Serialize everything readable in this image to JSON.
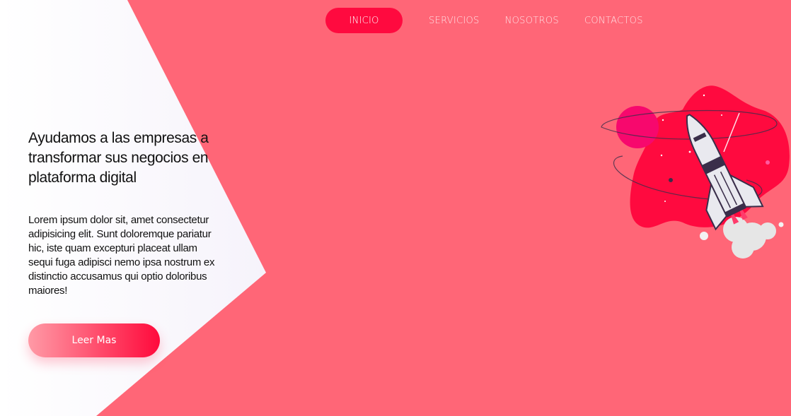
{
  "colors": {
    "background": "#ff6677",
    "panel": "#faf8fc",
    "accent": "#ff0a3f",
    "text": "#111111"
  },
  "nav": {
    "items": [
      {
        "label": "INICIO",
        "active": true
      },
      {
        "label": "SERVICIOS",
        "active": false
      },
      {
        "label": "NOSOTROS",
        "active": false
      },
      {
        "label": "CONTACTOS",
        "active": false
      }
    ]
  },
  "hero": {
    "title": "Ayudamos a las empresas a transformar sus negocios en plataforma digital",
    "text": "Lorem ipsum dolor sit, amet consectetur adipisicing elit. Sunt doloremque pariatur hic, iste quam excepturi placeat ullam sequi fuga adipisci nemo ipsa nostrum ex distinctio accusamus qui optio doloribus maiores!",
    "button_label": "Leer Mas"
  },
  "illustration": {
    "icon": "rocket-launch-icon"
  }
}
